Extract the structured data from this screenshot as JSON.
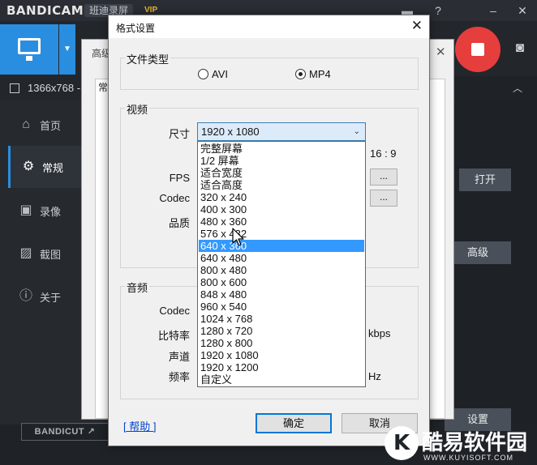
{
  "app": {
    "logo": "BANDICAM",
    "logo_sub": "班迪录屏",
    "vip": "VIP",
    "resolution": "1366x768 -",
    "nav": [
      {
        "label": "首页",
        "icon": "home-icon"
      },
      {
        "label": "常规",
        "icon": "gear-icon"
      },
      {
        "label": "录像",
        "icon": "video-icon"
      },
      {
        "label": "截图",
        "icon": "image-icon"
      },
      {
        "label": "关于",
        "icon": "info-icon"
      }
    ],
    "open_label": "打开",
    "advanced_label": "高级",
    "settings_label": "设置",
    "bandicut_label": "BANDICUT ↗",
    "bg_dialog_title": "高级",
    "bg_tab_label": "常"
  },
  "dialog": {
    "title": "格式设置",
    "file_type_group": "文件类型",
    "avi_label": "AVI",
    "mp4_label": "MP4",
    "selected_format": "MP4",
    "video_group": "视频",
    "size_label": "尺寸",
    "size_value": "1920 x 1080",
    "aspect": "16 : 9",
    "fps_label": "FPS",
    "codec_label": "Codec",
    "quality_label": "品质",
    "dots": "...",
    "size_options": [
      "完整屏幕",
      "1/2 屏幕",
      "适合宽度",
      "适合高度",
      "320 x 240",
      "400 x 300",
      "480 x 360",
      "576 x 432",
      "640 x 360",
      "640 x 480",
      "800 x 480",
      "800 x 600",
      "848 x 480",
      "960 x 540",
      "1024 x 768",
      "1280 x 720",
      "1280 x 800",
      "1920 x 1080",
      "1920 x 1200",
      "自定义"
    ],
    "highlighted_option": "640 x 360",
    "audio_group": "音频",
    "audio_codec_label": "Codec",
    "bitrate_label": "比特率",
    "bitrate_unit": "kbps",
    "channel_label": "声道",
    "freq_label": "频率",
    "freq_unit": "Hz",
    "help_label": "[ 帮助 ]",
    "ok_label": "确定",
    "cancel_label": "取消"
  },
  "watermark": {
    "text": "酷易软件园",
    "url": "WWW.KUYISOFT.COM"
  }
}
